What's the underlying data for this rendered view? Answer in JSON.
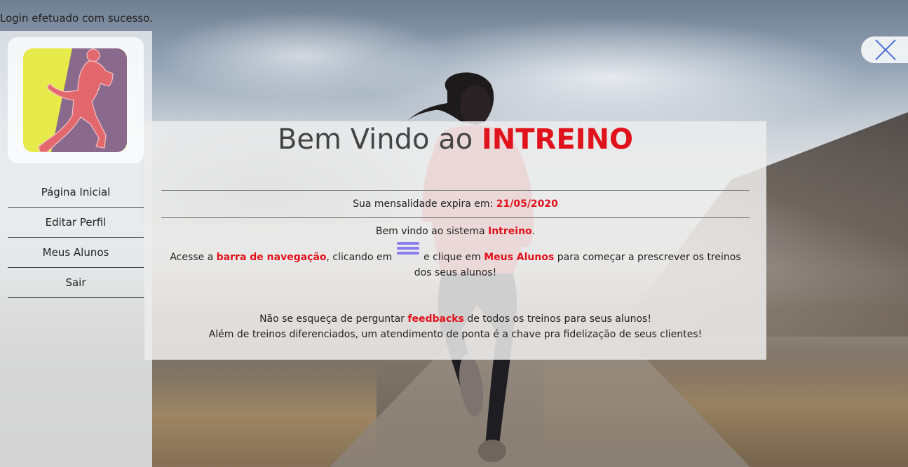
{
  "status": {
    "login_message": "Login efetuado com sucesso."
  },
  "sidebar": {
    "logo_icon": "runner-logo-icon",
    "items": [
      {
        "label": "Página Inicial"
      },
      {
        "label": "Editar Perfil"
      },
      {
        "label": "Meus Alunos"
      },
      {
        "label": "Sair"
      }
    ]
  },
  "close_button": {
    "icon": "close-icon"
  },
  "panel": {
    "title_prefix": "Bem Vindo ao ",
    "title_brand": "INTREINO",
    "expire_label": "Sua mensalidade expira em: ",
    "expire_date": "21/05/2020",
    "welcome_prefix": "Bem vindo ao sistema ",
    "welcome_brand": "Intreino",
    "welcome_suffix": ".",
    "access_prefix": "Acesse a ",
    "access_link": "barra de navegação",
    "access_mid": ", clicando em ",
    "access_mid2": " e clique em ",
    "access_highlight": "Meus Alunos",
    "access_suffix": " para começar a prescrever os treinos dos seus alunos!",
    "feedback_prefix": "Não se esqueça de perguntar ",
    "feedback_highlight": "feedbacks",
    "feedback_suffix": " de todos os treinos para seus alunos!",
    "closing_line": "Além de treinos diferenciados, um atendimento de ponta é a chave pra fidelização de seus clientes!",
    "hamburger_icon": "hamburger-menu-icon"
  },
  "colors": {
    "brand_red": "#e0121b",
    "hamburger_purple": "#8d7cf0",
    "logo_yellow": "#e6ea4a",
    "logo_purple": "#8a6a8c",
    "logo_runner": "#e3686d"
  }
}
